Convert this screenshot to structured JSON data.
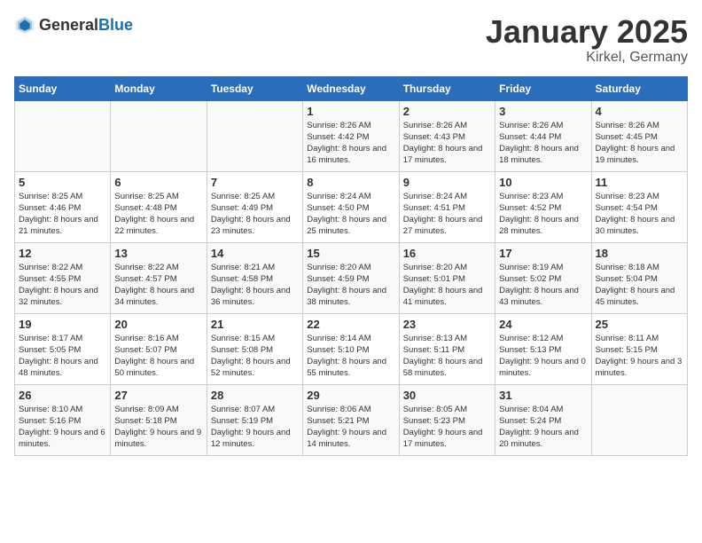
{
  "header": {
    "logo_general": "General",
    "logo_blue": "Blue",
    "month": "January 2025",
    "location": "Kirkel, Germany"
  },
  "weekdays": [
    "Sunday",
    "Monday",
    "Tuesday",
    "Wednesday",
    "Thursday",
    "Friday",
    "Saturday"
  ],
  "weeks": [
    [
      {
        "day": "",
        "sunrise": "",
        "sunset": "",
        "daylight": ""
      },
      {
        "day": "",
        "sunrise": "",
        "sunset": "",
        "daylight": ""
      },
      {
        "day": "",
        "sunrise": "",
        "sunset": "",
        "daylight": ""
      },
      {
        "day": "1",
        "sunrise": "Sunrise: 8:26 AM",
        "sunset": "Sunset: 4:42 PM",
        "daylight": "Daylight: 8 hours and 16 minutes."
      },
      {
        "day": "2",
        "sunrise": "Sunrise: 8:26 AM",
        "sunset": "Sunset: 4:43 PM",
        "daylight": "Daylight: 8 hours and 17 minutes."
      },
      {
        "day": "3",
        "sunrise": "Sunrise: 8:26 AM",
        "sunset": "Sunset: 4:44 PM",
        "daylight": "Daylight: 8 hours and 18 minutes."
      },
      {
        "day": "4",
        "sunrise": "Sunrise: 8:26 AM",
        "sunset": "Sunset: 4:45 PM",
        "daylight": "Daylight: 8 hours and 19 minutes."
      }
    ],
    [
      {
        "day": "5",
        "sunrise": "Sunrise: 8:25 AM",
        "sunset": "Sunset: 4:46 PM",
        "daylight": "Daylight: 8 hours and 21 minutes."
      },
      {
        "day": "6",
        "sunrise": "Sunrise: 8:25 AM",
        "sunset": "Sunset: 4:48 PM",
        "daylight": "Daylight: 8 hours and 22 minutes."
      },
      {
        "day": "7",
        "sunrise": "Sunrise: 8:25 AM",
        "sunset": "Sunset: 4:49 PM",
        "daylight": "Daylight: 8 hours and 23 minutes."
      },
      {
        "day": "8",
        "sunrise": "Sunrise: 8:24 AM",
        "sunset": "Sunset: 4:50 PM",
        "daylight": "Daylight: 8 hours and 25 minutes."
      },
      {
        "day": "9",
        "sunrise": "Sunrise: 8:24 AM",
        "sunset": "Sunset: 4:51 PM",
        "daylight": "Daylight: 8 hours and 27 minutes."
      },
      {
        "day": "10",
        "sunrise": "Sunrise: 8:23 AM",
        "sunset": "Sunset: 4:52 PM",
        "daylight": "Daylight: 8 hours and 28 minutes."
      },
      {
        "day": "11",
        "sunrise": "Sunrise: 8:23 AM",
        "sunset": "Sunset: 4:54 PM",
        "daylight": "Daylight: 8 hours and 30 minutes."
      }
    ],
    [
      {
        "day": "12",
        "sunrise": "Sunrise: 8:22 AM",
        "sunset": "Sunset: 4:55 PM",
        "daylight": "Daylight: 8 hours and 32 minutes."
      },
      {
        "day": "13",
        "sunrise": "Sunrise: 8:22 AM",
        "sunset": "Sunset: 4:57 PM",
        "daylight": "Daylight: 8 hours and 34 minutes."
      },
      {
        "day": "14",
        "sunrise": "Sunrise: 8:21 AM",
        "sunset": "Sunset: 4:58 PM",
        "daylight": "Daylight: 8 hours and 36 minutes."
      },
      {
        "day": "15",
        "sunrise": "Sunrise: 8:20 AM",
        "sunset": "Sunset: 4:59 PM",
        "daylight": "Daylight: 8 hours and 38 minutes."
      },
      {
        "day": "16",
        "sunrise": "Sunrise: 8:20 AM",
        "sunset": "Sunset: 5:01 PM",
        "daylight": "Daylight: 8 hours and 41 minutes."
      },
      {
        "day": "17",
        "sunrise": "Sunrise: 8:19 AM",
        "sunset": "Sunset: 5:02 PM",
        "daylight": "Daylight: 8 hours and 43 minutes."
      },
      {
        "day": "18",
        "sunrise": "Sunrise: 8:18 AM",
        "sunset": "Sunset: 5:04 PM",
        "daylight": "Daylight: 8 hours and 45 minutes."
      }
    ],
    [
      {
        "day": "19",
        "sunrise": "Sunrise: 8:17 AM",
        "sunset": "Sunset: 5:05 PM",
        "daylight": "Daylight: 8 hours and 48 minutes."
      },
      {
        "day": "20",
        "sunrise": "Sunrise: 8:16 AM",
        "sunset": "Sunset: 5:07 PM",
        "daylight": "Daylight: 8 hours and 50 minutes."
      },
      {
        "day": "21",
        "sunrise": "Sunrise: 8:15 AM",
        "sunset": "Sunset: 5:08 PM",
        "daylight": "Daylight: 8 hours and 52 minutes."
      },
      {
        "day": "22",
        "sunrise": "Sunrise: 8:14 AM",
        "sunset": "Sunset: 5:10 PM",
        "daylight": "Daylight: 8 hours and 55 minutes."
      },
      {
        "day": "23",
        "sunrise": "Sunrise: 8:13 AM",
        "sunset": "Sunset: 5:11 PM",
        "daylight": "Daylight: 8 hours and 58 minutes."
      },
      {
        "day": "24",
        "sunrise": "Sunrise: 8:12 AM",
        "sunset": "Sunset: 5:13 PM",
        "daylight": "Daylight: 9 hours and 0 minutes."
      },
      {
        "day": "25",
        "sunrise": "Sunrise: 8:11 AM",
        "sunset": "Sunset: 5:15 PM",
        "daylight": "Daylight: 9 hours and 3 minutes."
      }
    ],
    [
      {
        "day": "26",
        "sunrise": "Sunrise: 8:10 AM",
        "sunset": "Sunset: 5:16 PM",
        "daylight": "Daylight: 9 hours and 6 minutes."
      },
      {
        "day": "27",
        "sunrise": "Sunrise: 8:09 AM",
        "sunset": "Sunset: 5:18 PM",
        "daylight": "Daylight: 9 hours and 9 minutes."
      },
      {
        "day": "28",
        "sunrise": "Sunrise: 8:07 AM",
        "sunset": "Sunset: 5:19 PM",
        "daylight": "Daylight: 9 hours and 12 minutes."
      },
      {
        "day": "29",
        "sunrise": "Sunrise: 8:06 AM",
        "sunset": "Sunset: 5:21 PM",
        "daylight": "Daylight: 9 hours and 14 minutes."
      },
      {
        "day": "30",
        "sunrise": "Sunrise: 8:05 AM",
        "sunset": "Sunset: 5:23 PM",
        "daylight": "Daylight: 9 hours and 17 minutes."
      },
      {
        "day": "31",
        "sunrise": "Sunrise: 8:04 AM",
        "sunset": "Sunset: 5:24 PM",
        "daylight": "Daylight: 9 hours and 20 minutes."
      },
      {
        "day": "",
        "sunrise": "",
        "sunset": "",
        "daylight": ""
      }
    ]
  ]
}
